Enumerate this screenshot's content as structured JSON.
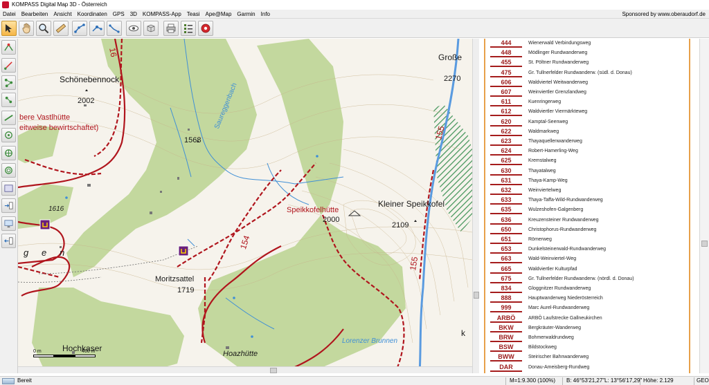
{
  "window": {
    "title": "KOMPASS Digital Map 3D - Österreich",
    "sponsor": "Sponsored by www.oberaudorf.de"
  },
  "menu": [
    "Datei",
    "Bearbeiten",
    "Ansicht",
    "Koordinaten",
    "GPS",
    "3D",
    "KOMPASS-App",
    "Teasi",
    "Ape@Map",
    "Garmin",
    "Info"
  ],
  "toolbar_icons": [
    "cursor-arrow-icon",
    "hand-pan-icon",
    "zoom-magnifier-icon",
    "measure-ruler-icon",
    "route-waypoints-icon",
    "route-edit-icon",
    "track-icon",
    "view-eye-icon",
    "3d-view-icon",
    "print-icon",
    "list-icon",
    "settings-red-icon"
  ],
  "left_tools": [
    "route-new-icon",
    "route-draw-icon",
    "route-nodes-icon",
    "route-nodes-add-icon",
    "route-segment-icon",
    "route-export-icon",
    "gps-receive-icon",
    "gps-send-icon",
    "map-export-icon",
    "device-send-icon",
    "screen-export-icon",
    "device-receive-icon"
  ],
  "map": {
    "labels": [
      {
        "text": "Schönebennock",
        "kind": "peak"
      },
      {
        "text": "2002",
        "kind": "elev"
      },
      {
        "text": "bere Vastlhütte",
        "kind": "hut"
      },
      {
        "text": "eitweise bewirtschaftet)",
        "kind": "hut"
      },
      {
        "text": "1568",
        "kind": "elev"
      },
      {
        "text": "Saureggenbach",
        "kind": "water"
      },
      {
        "text": "16",
        "kind": "trail"
      },
      {
        "text": "1616",
        "kind": "elev-italic"
      },
      {
        "text": "g",
        "kind": "region"
      },
      {
        "text": "e",
        "kind": "region"
      },
      {
        "text": "n",
        "kind": "region"
      },
      {
        "text": "Moritzsattel",
        "kind": "place"
      },
      {
        "text": "1719",
        "kind": "elev"
      },
      {
        "text": "154",
        "kind": "trail"
      },
      {
        "text": "Speikkofelhütte",
        "kind": "hut"
      },
      {
        "text": "2000",
        "kind": "elev"
      },
      {
        "text": "Kleiner Speikkofel",
        "kind": "peak"
      },
      {
        "text": "2109",
        "kind": "elev"
      },
      {
        "text": "Große",
        "kind": "peak"
      },
      {
        "text": "2270",
        "kind": "elev"
      },
      {
        "text": "155",
        "kind": "trail"
      },
      {
        "text": "155",
        "kind": "trail"
      },
      {
        "text": "Lorenzer Brunnen",
        "kind": "water"
      },
      {
        "text": "Hoazhütte",
        "kind": "place-italic"
      },
      {
        "text": "Hochkaser",
        "kind": "place"
      },
      {
        "text": "k",
        "kind": "region"
      }
    ],
    "scale": {
      "left": "0 m",
      "right": "400 m"
    }
  },
  "legend": [
    {
      "num": "444",
      "name": "Wienerwald Verbindungsweg"
    },
    {
      "num": "448",
      "name": "Mödlinger Rundwanderweg"
    },
    {
      "num": "455",
      "name": "St. Pöltner Rundwanderweg"
    },
    {
      "num": "475",
      "name": "Gr. Tullnerfelder Rundwanderw. (südl. d. Donau)"
    },
    {
      "num": "606",
      "name": "Waldviertel Weitwanderweg"
    },
    {
      "num": "607",
      "name": "Weinviertler Grenzlandweg"
    },
    {
      "num": "611",
      "name": "Kuenringerweg"
    },
    {
      "num": "612",
      "name": "Waldviertler Viermärkteweg"
    },
    {
      "num": "620",
      "name": "Kamptal-Seenweg"
    },
    {
      "num": "622",
      "name": "Waldmarkweg"
    },
    {
      "num": "623",
      "name": "Thayaquellenwanderweg"
    },
    {
      "num": "624",
      "name": "Robert-Hamerling-Weg"
    },
    {
      "num": "625",
      "name": "Kremstalweg"
    },
    {
      "num": "630",
      "name": "Thayatalweg"
    },
    {
      "num": "631",
      "name": "Thaya-Kamp-Weg"
    },
    {
      "num": "632",
      "name": "Weinviertelweg"
    },
    {
      "num": "633",
      "name": "Thaya-Taffa-Wild-Rundwanderweg"
    },
    {
      "num": "635",
      "name": "Wulzeshofen-Galgenberg"
    },
    {
      "num": "636",
      "name": "Kreuzensteiner Rundwanderweg"
    },
    {
      "num": "650",
      "name": "Christophorus-Rundwanderweg"
    },
    {
      "num": "651",
      "name": "Römerweg"
    },
    {
      "num": "653",
      "name": "Dunkelsteinerwald-Rundwanderweg"
    },
    {
      "num": "663",
      "name": "Wald-Weinviertel-Weg"
    },
    {
      "num": "665",
      "name": "Waldviertler Kulturpfad"
    },
    {
      "num": "675",
      "name": "Gr. Tullnerfelder Rundwanderw. (nördl. d. Donau)"
    },
    {
      "num": "834",
      "name": "Gloggnitzer Rundwanderweg"
    },
    {
      "num": "888",
      "name": "Hauptwanderweg Niederösterreich"
    },
    {
      "num": "999",
      "name": "Marc Aurel-Rundwanderweg"
    },
    {
      "num": "ARBÖ",
      "name": "ARBÖ Laufstrecke Gallneukirchen"
    },
    {
      "num": "BKW",
      "name": "Bergkräuter-Wanderweg"
    },
    {
      "num": "BRW",
      "name": "Bohmerwaldrundweg"
    },
    {
      "num": "BSW",
      "name": "Bildstockweg"
    },
    {
      "num": "BWW",
      "name": "Steirischer Bahnwanderweg"
    },
    {
      "num": "DAR",
      "name": "Donau-Ameisberg-Rundweg"
    }
  ],
  "status": {
    "ready": "Bereit",
    "scale": "M=1:9.300 (100%)",
    "lat": "B: 46°53'21,27\"",
    "lon": "L: 13°56'17,29\"",
    "height": "Höhe: 2.129",
    "geo": "GEO"
  },
  "colors": {
    "forest": "#bfd69a",
    "trail": "#b0151d",
    "water": "#3f8fd6",
    "legend_border": "#e7a04a"
  }
}
